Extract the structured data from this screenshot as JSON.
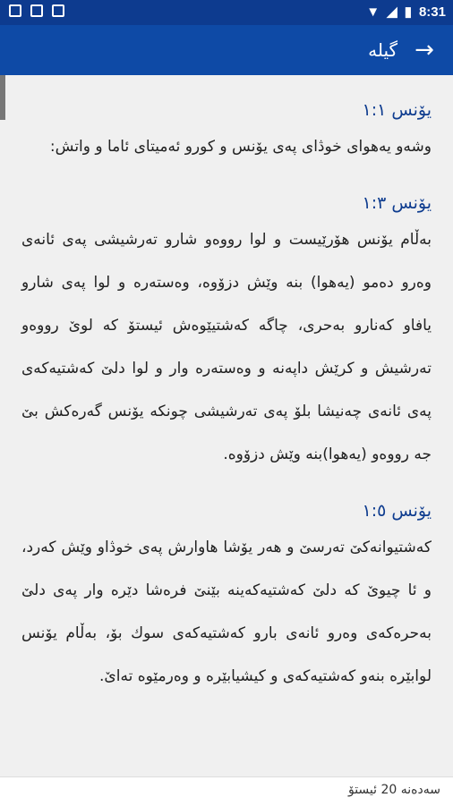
{
  "status": {
    "time": "8:31"
  },
  "appbar": {
    "title": "گیلە"
  },
  "verses": [
    {
      "ref": "یۆنس ١:١",
      "text": "وشەو یەهوای خوڎای پەی یۆنس و کورو ئەمیتای ئاما و واتش:"
    },
    {
      "ref": "یۆنس ١:٣",
      "text": "بەڵام یۆنس هۆرێیست و لوا رووەو شارو تەرشیشی پەی ئانەی وەرو دەمو (یەهوا) بنە وێش دزۆوە، وەستەرە و لوا پەی شارو یافاو کەنارو بەحری، چاگە کەشتیێوەش ئیستۆ کە لوێ رووەو تەرشیش و کرێش داپەنە و وەستەرە وار و لوا دلێ کەشتیەکەی پەی ئانەی چەنیشا بلۆ پەی تەرشیشی چونکە یۆنس گەرەکش بێ جە رووەو (یەهوا)بنە وێش دزۆوە."
    },
    {
      "ref": "یۆنس ١:٥",
      "text": "کەشتیوانەکێ تەرسێ و هەر یۆشا هاوارش پەی خوڎاو وێش کەرد، و ئا چیوێ کە دلێ کەشتیەکەینە بێنێ فرەشا دێرە وار پەی دلێ بەحرەکەی وەرو ئانەی بارو کەشتیەکەی سوك بۆ، بەڵام یۆنس لوابێرە بنەو کەشتیەکەی و کیشیابێرە و وەرمێوە تەاێ."
    }
  ],
  "bottom": {
    "label": "سەدەنە 20 ئیستۆ"
  }
}
